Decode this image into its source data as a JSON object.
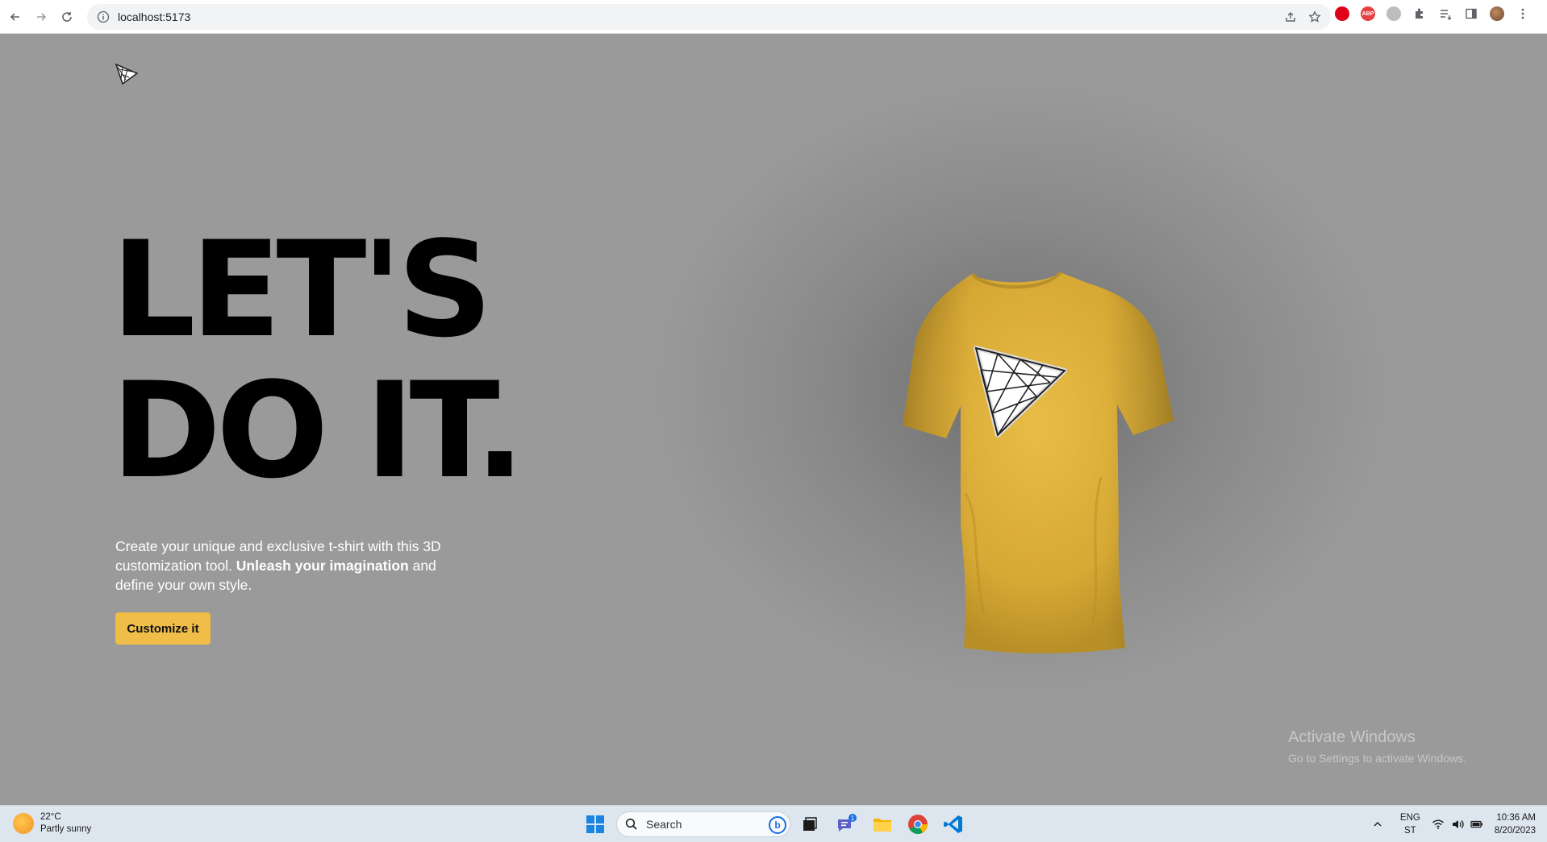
{
  "browser": {
    "url": "localhost:5173",
    "extensions": [
      "opera-icon",
      "adblock-plus-icon",
      "extension-grey-icon",
      "puzzle-icon",
      "reading-list-icon",
      "side-panel-icon",
      "profile-avatar"
    ],
    "abp_label": "ABP"
  },
  "hero": {
    "headline_line1": "LET'S",
    "headline_line2": "DO IT.",
    "intro_part1": "Create your unique and exclusive t-shirt with this 3D customization tool. ",
    "intro_bold": "Unleash your imagination",
    "intro_part2": " and define your own style.",
    "cta_label": "Customize it"
  },
  "shirt": {
    "color": "#e6b93e",
    "logo": "triangle-mesh-logo"
  },
  "watermark": {
    "line1": "Activate Windows",
    "line2": "Go to Settings to activate Windows."
  },
  "taskbar": {
    "weather_temp": "22°C",
    "weather_desc": "Partly sunny",
    "search_placeholder": "Search",
    "teams_badge": "1",
    "lang_line1": "ENG",
    "lang_line2": "ST",
    "time": "10:36 AM",
    "date": "8/20/2023"
  },
  "colors": {
    "accent": "#efbd48",
    "page_bg": "#9a9a9a"
  }
}
